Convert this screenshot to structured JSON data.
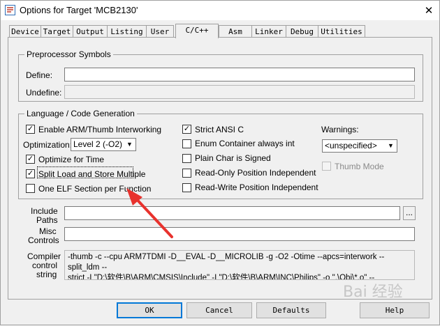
{
  "window": {
    "title": "Options for Target 'MCB2130'"
  },
  "tabs": [
    {
      "label": "Device"
    },
    {
      "label": "Target"
    },
    {
      "label": "Output"
    },
    {
      "label": "Listing"
    },
    {
      "label": "User"
    },
    {
      "label": "C/C++"
    },
    {
      "label": "Asm"
    },
    {
      "label": "Linker"
    },
    {
      "label": "Debug"
    },
    {
      "label": "Utilities"
    }
  ],
  "active_tab": "C/C++",
  "preprocessor": {
    "group_title": "Preprocessor Symbols",
    "define_label": "Define:",
    "define_value": "",
    "undefine_label": "Undefine:",
    "undefine_value": ""
  },
  "language": {
    "group_title": "Language / Code Generation",
    "arm_thumb_label": "Enable ARM/Thumb Interworking",
    "arm_thumb_checked": "✓",
    "optimization_label": "Optimization:",
    "optimization_value": "Level 2 (-O2)",
    "optimize_time_label": "Optimize for Time",
    "optimize_time_checked": "✓",
    "split_load_label": "Split Load and Store Multiple",
    "split_load_checked": "✓",
    "one_elf_label": "One ELF Section per Function",
    "one_elf_checked": "",
    "strict_ansi_label": "Strict ANSI C",
    "strict_ansi_checked": "✓",
    "enum_label": "Enum Container always int",
    "plain_char_label": "Plain Char is Signed",
    "ro_pi_label": "Read-Only Position Independent",
    "rw_pi_label": "Read-Write Position Independent",
    "warnings_label": "Warnings:",
    "warnings_value": "<unspecified>",
    "thumb_mode_label": "Thumb Mode"
  },
  "include_paths_label_1": "Include",
  "include_paths_label_2": "Paths",
  "include_paths_value": "",
  "browse_label": "...",
  "misc_label_1": "Misc",
  "misc_label_2": "Controls",
  "misc_value": "",
  "compiler_label_1": "Compiler",
  "compiler_label_2": "control",
  "compiler_label_3": "string",
  "compiler_string_line1": "-thumb -c --cpu ARM7TDMI -D__EVAL -D__MICROLIB -g -O2 -Otime --apcs=interwork --split_ldm --",
  "compiler_string_line2": "strict -I \"D:\\软件\\B\\ARM\\CMSIS\\Include\" -I \"D:\\软件\\B\\ARM\\INC\\Philips\" -o \".\\Obj\\*.o\" --",
  "buttons": {
    "ok": "OK",
    "cancel": "Cancel",
    "defaults": "Defaults",
    "help": "Help"
  },
  "colors": {
    "annotation_arrow": "#e8322d",
    "default_button_border": "#0078d7"
  },
  "watermark": "Bai 经验"
}
